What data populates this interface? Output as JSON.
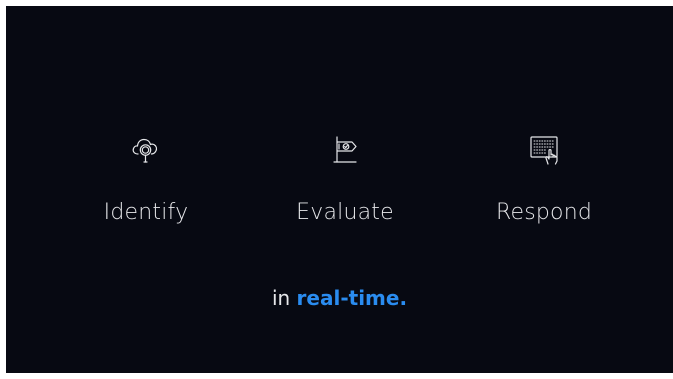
{
  "colors": {
    "background": "#070912",
    "text": "#e6e7ea",
    "accent": "#2a8cf0"
  },
  "steps": [
    {
      "label": "Identify",
      "icon": "cloud-search-icon"
    },
    {
      "label": "Evaluate",
      "icon": "flag-check-icon"
    },
    {
      "label": "Respond",
      "icon": "touch-screen-icon"
    }
  ],
  "tagline": {
    "prefix": "in",
    "accent": "real-time."
  }
}
